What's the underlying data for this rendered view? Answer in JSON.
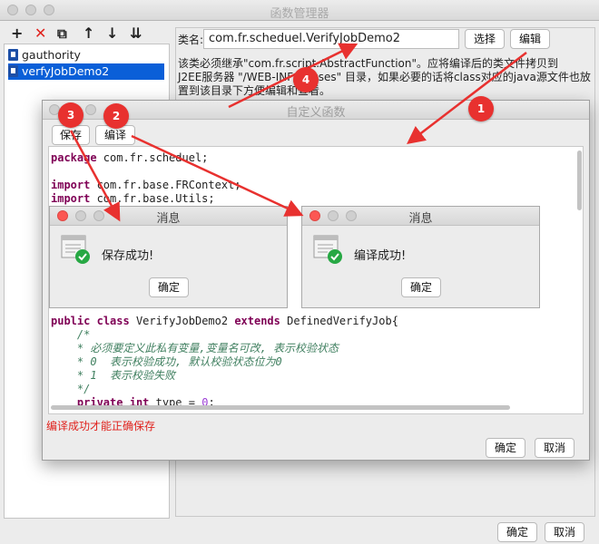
{
  "window": {
    "title": "函数管理器"
  },
  "toolbar": {
    "add": "+",
    "delete": "✕",
    "copy": "⧉",
    "up": "↑",
    "down": "↓",
    "sort": "⇊"
  },
  "tree": {
    "items": [
      {
        "label": "gauthority"
      },
      {
        "label": "verfyJobDemo2"
      }
    ]
  },
  "form": {
    "class_label": "类名:",
    "class_value": "com.fr.scheduel.VerifyJobDemo2",
    "choose_label": "选择",
    "edit_label": "编辑",
    "description_line1": "该类必须继承\"com.fr.script.AbstractFunction\"。应将编译后的类文件拷贝到",
    "description_line2": "J2EE服务器 \"/WEB-INF/classes\" 目录，如果必要的话将class对应的java源文件也放",
    "description_line3": "置到该目录下方便编辑和查看。"
  },
  "dialog": {
    "title": "自定义函数",
    "save_label": "保存",
    "compile_label": "编译",
    "code_lines": [
      "package com.fr.scheduel;",
      "",
      "import com.fr.base.FRContext;",
      "import com.fr.base.Utils;",
      "public class VerifyJobDemo2 extends DefinedVerifyJob{",
      "    /*",
      "    * 必须要定义此私有变量,变量名可改, 表示校验状态",
      "    * 0  表示校验成功, 默认校验状态位为0",
      "    * 1  表示校验失败",
      "    */",
      "    private int type = 0;"
    ],
    "kw_package": "package",
    "pkg_rest": " com.fr.scheduel;",
    "kw_import": "import",
    "import1_rest": " com.fr.base.FRContext;",
    "import2_rest": " com.fr.base.Utils;",
    "kw_public": "public",
    "kw_class": "class",
    "class_name": " VerifyJobDemo2 ",
    "kw_extends": "extends",
    "class_rest": " DefinedVerifyJob{",
    "cm1": "    /*",
    "cm2": "    * 必须要定义此私有变量,变量名可改, 表示校验状态",
    "cm3": "    * 0  表示校验成功, 默认校验状态位为0",
    "cm4": "    * 1  表示校验失败",
    "cm5": "    */",
    "kw_private": "private",
    "kw_int": "int",
    "type_rest": " type = ",
    "type_val": "0",
    "type_end": ";",
    "warning": "编译成功才能正确保存",
    "ok_label": "确定",
    "cancel_label": "取消"
  },
  "msg_save": {
    "title": "消息",
    "text": "保存成功!",
    "ok_label": "确定"
  },
  "msg_compile": {
    "title": "消息",
    "text": "编译成功!",
    "ok_label": "确定"
  },
  "footer": {
    "ok_label": "确定",
    "cancel_label": "取消"
  },
  "callouts": {
    "c1": "1",
    "c2": "2",
    "c3": "3",
    "c4": "4"
  },
  "colors": {
    "accent_red": "#e8312f",
    "selection_blue": "#0a5fd8",
    "warning_red": "#e0221d"
  }
}
